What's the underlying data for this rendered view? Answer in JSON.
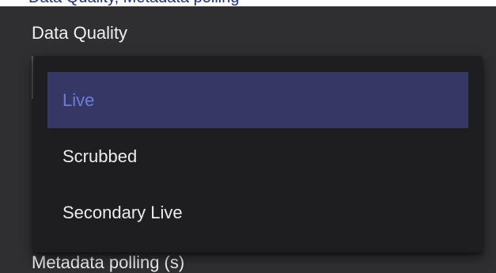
{
  "background_text": "Data Quality, Metadata polling",
  "section": {
    "label": "Data Quality"
  },
  "select": {
    "selected_value": "Live",
    "options": [
      {
        "label": "Live",
        "selected": true
      },
      {
        "label": "Scrubbed",
        "selected": false
      },
      {
        "label": "Secondary Live",
        "selected": false
      }
    ]
  },
  "next_field": {
    "label": "Metadata polling (s)"
  },
  "colors": {
    "panel_bg": "#2f2f31",
    "menu_bg": "#1e1e21",
    "selected_bg": "#353865",
    "selected_text": "#6f7bd6",
    "text": "#ececef"
  }
}
